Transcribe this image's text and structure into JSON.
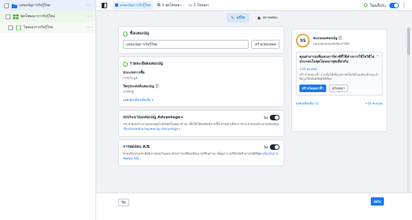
{
  "sidebar": {
    "items": [
      {
        "label": "แคมเปญการรับรู้ใหม่",
        "level": "campaign"
      },
      {
        "label": "ชุดโฆษณาการรับรู้ใหม่",
        "level": "adset"
      },
      {
        "label": "โฆษณาการรับรู้ใหม่",
        "level": "ad"
      }
    ],
    "more": "···"
  },
  "topbar": {
    "crumbs": [
      {
        "label": "แคมเปญการรับรู้ใหม่",
        "icon": "folder-icon"
      },
      {
        "label": "1 ชุดโฆษณา",
        "icon": "grid-icon"
      },
      {
        "label": "1 โฆษณา",
        "icon": "page-icon"
      }
    ],
    "status": "ไม่ผลีประ"
  },
  "modes": {
    "edit": "แก้ไข",
    "review": "ตรวจสอบ"
  },
  "campaign_name": {
    "title": "ชื่อแคมเปญ",
    "value": "แคมเปญการรับรู้ใหม่",
    "template_button": "สร้างเทมเพลต"
  },
  "details": {
    "title": "รายละเอียดแคมเปญ",
    "purchase_label": "ประเภทการซื้อ",
    "purchase_value": "การประมูล",
    "objective_label": "วัตถุประสงค์แคมเปญ",
    "objective_value": "การรับรู้",
    "more_link": "แสดงตัวเลือกเพิ่มเติม"
  },
  "advantage": {
    "title": "งบประมาณแคมเปญ Advantage+",
    "toggle_label": "ปิด",
    "desc": "กระจายงบประมาณของคุณไปยังชุดโฆษณาต่างๆ เพื่อให้ได้ผลลัพธ์มากขึ้น ตามตัวเลือกการกระจายงบประมาณของคุณ",
    "link": "เกี่ยวกับงบประมาณแคมเปญ Advantage+"
  },
  "ab_test": {
    "title": "การทดสอบ A/B",
    "toggle_label": "ปิด",
    "desc": "ช่วยปรับปรุงประสิทธิภาพของโฆษณาด้วยการเปรียบเทียบเวอร์ชันต่างๆ เพื่อดูว่าเวอร์ชันใดทำงานได้ดีที่สุด",
    "link": "เกี่ยวกับการทดสอบ A/B"
  },
  "score": {
    "value": "55",
    "title": "คะแนนแคมเปญ",
    "sub": "แคมเปญของคุณยังพัฒนาได้อีก"
  },
  "recommendation": {
    "title": "คุณสามารถเพิ่มอเนการ์ตาซ์ที่ใช้ต่างการใช้ใจวิดีโอประกอบในชุดโฆษณาชุดเดียวกัน",
    "boost": "+35 คะแนน",
    "desc": "สร้างโฆษณาซ้ำ จากนั้นให้เพิ่มรูปภาพเป็นวิดีโอแต่ละคำแนะนำจัดรูปให้ได้ผลลัพธ์ที่ดีที่สุด",
    "primary": "สร้างโฆษณาซ้ำ",
    "secondary": "ดูโฆษณา"
  },
  "right_footer": {
    "more": "แสดงเพิ่มเติม (1)",
    "points": "+10 คะแนน"
  },
  "bottom": {
    "close": "ปิด",
    "next": "ถัดไป"
  }
}
